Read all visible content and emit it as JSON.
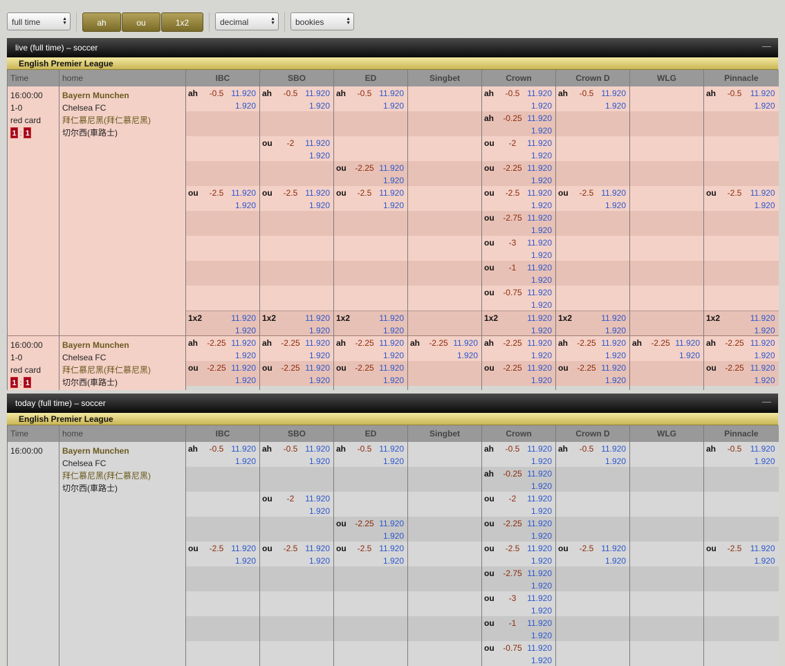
{
  "toolbar": {
    "period": "full time",
    "market_buttons": [
      "ah",
      "ou",
      "1x2"
    ],
    "odds_format": "decimal",
    "bookies": "bookies"
  },
  "colors": {
    "gold_button": "#8f7f35",
    "live_row": "#f4d1c7",
    "today_row": "#d7d7d7",
    "odds_blue": "#2a56cc",
    "line_red": "#8b2a0a"
  },
  "bookies": [
    "IBC",
    "SBO",
    "ED",
    "Singbet",
    "Crown",
    "Crown D",
    "WLG",
    "Pinnacle"
  ],
  "headers": {
    "time": "Time",
    "home": "home"
  },
  "live": {
    "title": "live (full time) – soccer",
    "collapse_icon": "—",
    "league": "English Premier League",
    "matches": [
      {
        "time": "16:00:00",
        "score": "1-0",
        "card": "red card",
        "red_home": "1",
        "red_away": "1",
        "team_home": "Bayern Munchen",
        "team_away": "Chelsea FC",
        "team_home_cn": "拜仁慕尼黑(拜仁慕尼黑)",
        "team_away_cn": "切尔西(車路士)",
        "rows": [
          [
            [
              "ah",
              "-0.5",
              "11.920",
              "1.920"
            ],
            [
              "ah",
              "-0.5",
              "11.920",
              "1.920"
            ],
            [
              "ah",
              "-0.5",
              "11.920",
              "1.920"
            ],
            null,
            [
              "ah",
              "-0.5",
              "11.920",
              "1.920"
            ],
            [
              "ah",
              "-0.5",
              "11.920",
              "1.920"
            ],
            null,
            [
              "ah",
              "-0.5",
              "11.920",
              "1.920"
            ]
          ],
          [
            null,
            null,
            null,
            null,
            [
              "ah",
              "-0.25",
              "11.920",
              "1.920"
            ],
            null,
            null,
            null
          ],
          [
            null,
            [
              "ou",
              "-2",
              "11.920",
              "1.920"
            ],
            null,
            null,
            [
              "ou",
              "-2",
              "11.920",
              "1.920"
            ],
            null,
            null,
            null
          ],
          [
            null,
            null,
            [
              "ou",
              "-2.25",
              "11.920",
              "1.920"
            ],
            null,
            [
              "ou",
              "-2.25",
              "11.920",
              "1.920"
            ],
            null,
            null,
            null
          ],
          [
            [
              "ou",
              "-2.5",
              "11.920",
              "1.920"
            ],
            [
              "ou",
              "-2.5",
              "11.920",
              "1.920"
            ],
            [
              "ou",
              "-2.5",
              "11.920",
              "1.920"
            ],
            null,
            [
              "ou",
              "-2.5",
              "11.920",
              "1.920"
            ],
            [
              "ou",
              "-2.5",
              "11.920",
              "1.920"
            ],
            null,
            [
              "ou",
              "-2.5",
              "11.920",
              "1.920"
            ]
          ],
          [
            null,
            null,
            null,
            null,
            [
              "ou",
              "-2.75",
              "11.920",
              "1.920"
            ],
            null,
            null,
            null
          ],
          [
            null,
            null,
            null,
            null,
            [
              "ou",
              "-3",
              "11.920",
              "1.920"
            ],
            null,
            null,
            null
          ],
          [
            null,
            null,
            null,
            null,
            [
              "ou",
              "-1",
              "11.920",
              "1.920"
            ],
            null,
            null,
            null
          ],
          [
            null,
            null,
            null,
            null,
            [
              "ou",
              "-0.75",
              "11.920",
              "1.920"
            ],
            null,
            null,
            null
          ],
          [
            [
              "1x2",
              "",
              "11.920",
              "1.920"
            ],
            [
              "1x2",
              "",
              "11.920",
              "1.920"
            ],
            [
              "1x2",
              "",
              "11.920",
              "1.920"
            ],
            null,
            [
              "1x2",
              "",
              "11.920",
              "1.920"
            ],
            [
              "1x2",
              "",
              "11.920",
              "1.920"
            ],
            null,
            [
              "1x2",
              "",
              "11.920",
              "1.920"
            ]
          ]
        ]
      },
      {
        "time": "16:00:00",
        "score": "1-0",
        "card": "red card",
        "red_home": "1",
        "red_away": "1",
        "team_home": "Bayern Munchen",
        "team_away": "Chelsea FC",
        "team_home_cn": "拜仁慕尼黑(拜仁慕尼黑)",
        "team_away_cn": "切尔西(車路士)",
        "rows": [
          [
            [
              "ah",
              "-2.25",
              "11.920",
              "1.920"
            ],
            [
              "ah",
              "-2.25",
              "11.920",
              "1.920"
            ],
            [
              "ah",
              "-2.25",
              "11.920",
              "1.920"
            ],
            [
              "ah",
              "-2.25",
              "11.920",
              "1.920"
            ],
            [
              "ah",
              "-2.25",
              "11.920",
              "1.920"
            ],
            [
              "ah",
              "-2.25",
              "11.920",
              "1.920"
            ],
            [
              "ah",
              "-2.25",
              "11.920",
              "1.920"
            ],
            [
              "ah",
              "-2.25",
              "11.920",
              "1.920"
            ]
          ],
          [
            [
              "ou",
              "-2.25",
              "11.920",
              "1.920"
            ],
            [
              "ou",
              "-2.25",
              "11.920",
              "1.920"
            ],
            [
              "ou",
              "-2.25",
              "11.920",
              "1.920"
            ],
            null,
            [
              "ou",
              "-2.25",
              "11.920",
              "1.920"
            ],
            [
              "ou",
              "-2.25",
              "11.920",
              "1.920"
            ],
            null,
            [
              "ou",
              "-2.25",
              "11.920",
              "1.920"
            ]
          ]
        ]
      }
    ]
  },
  "today": {
    "title": "today (full time) – soccer",
    "collapse_icon": "—",
    "league": "English Premier League",
    "matches": [
      {
        "time": "16:00:00",
        "team_home": "Bayern Munchen",
        "team_away": "Chelsea FC",
        "team_home_cn": "拜仁慕尼黑(拜仁慕尼黑)",
        "team_away_cn": "切尔西(車路士)",
        "rows": [
          [
            [
              "ah",
              "-0.5",
              "11.920",
              "1.920"
            ],
            [
              "ah",
              "-0.5",
              "11.920",
              "1.920"
            ],
            [
              "ah",
              "-0.5",
              "11.920",
              "1.920"
            ],
            null,
            [
              "ah",
              "-0.5",
              "11.920",
              "1.920"
            ],
            [
              "ah",
              "-0.5",
              "11.920",
              "1.920"
            ],
            null,
            [
              "ah",
              "-0.5",
              "11.920",
              "1.920"
            ]
          ],
          [
            null,
            null,
            null,
            null,
            [
              "ah",
              "-0.25",
              "11.920",
              "1.920"
            ],
            null,
            null,
            null
          ],
          [
            null,
            [
              "ou",
              "-2",
              "11.920",
              "1.920"
            ],
            null,
            null,
            [
              "ou",
              "-2",
              "11.920",
              "1.920"
            ],
            null,
            null,
            null
          ],
          [
            null,
            null,
            [
              "ou",
              "-2.25",
              "11.920",
              "1.920"
            ],
            null,
            [
              "ou",
              "-2.25",
              "11.920",
              "1.920"
            ],
            null,
            null,
            null
          ],
          [
            [
              "ou",
              "-2.5",
              "11.920",
              "1.920"
            ],
            [
              "ou",
              "-2.5",
              "11.920",
              "1.920"
            ],
            [
              "ou",
              "-2.5",
              "11.920",
              "1.920"
            ],
            null,
            [
              "ou",
              "-2.5",
              "11.920",
              "1.920"
            ],
            [
              "ou",
              "-2.5",
              "11.920",
              "1.920"
            ],
            null,
            [
              "ou",
              "-2.5",
              "11.920",
              "1.920"
            ]
          ],
          [
            null,
            null,
            null,
            null,
            [
              "ou",
              "-2.75",
              "11.920",
              "1.920"
            ],
            null,
            null,
            null
          ],
          [
            null,
            null,
            null,
            null,
            [
              "ou",
              "-3",
              "11.920",
              "1.920"
            ],
            null,
            null,
            null
          ],
          [
            null,
            null,
            null,
            null,
            [
              "ou",
              "-1",
              "11.920",
              "1.920"
            ],
            null,
            null,
            null
          ],
          [
            null,
            null,
            null,
            null,
            [
              "ou",
              "-0.75",
              "11.920",
              "1.920"
            ],
            null,
            null,
            null
          ]
        ]
      }
    ]
  }
}
